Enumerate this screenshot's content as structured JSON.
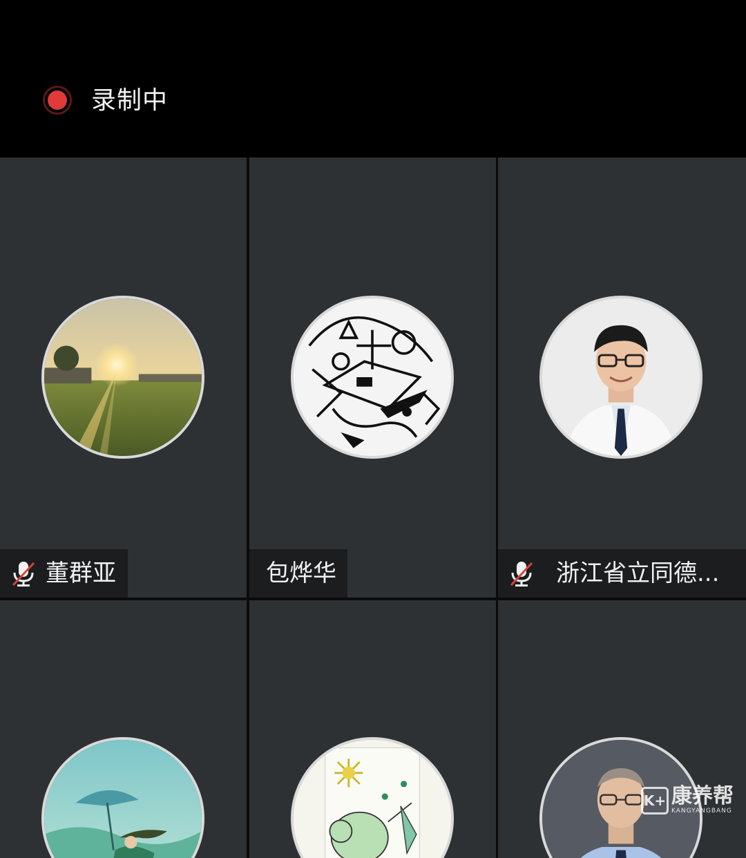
{
  "recording": {
    "label": "录制中",
    "icon": "record-icon",
    "color": "#e03a3a"
  },
  "participants": [
    {
      "name": "董群亚",
      "muted": true,
      "avatar": "sunset-field-photo"
    },
    {
      "name": "包烨华",
      "muted": false,
      "avatar": "doodle-art"
    },
    {
      "name": "浙江省立同德...",
      "muted": true,
      "avatar": "doctor-photo"
    },
    {
      "name": "",
      "muted": false,
      "avatar": "girl-umbrella-illustration"
    },
    {
      "name": "",
      "muted": false,
      "avatar": "elephant-sketch"
    },
    {
      "name": "",
      "muted": false,
      "avatar": "man-glasses-photo"
    }
  ],
  "watermark": {
    "badge": "K+",
    "name": "康养帮",
    "sub": "KANGYANGBANG"
  },
  "colors": {
    "tile_bg": "#2e3134",
    "topbar_bg": "#000000",
    "muted_slash": "#d9433a"
  }
}
